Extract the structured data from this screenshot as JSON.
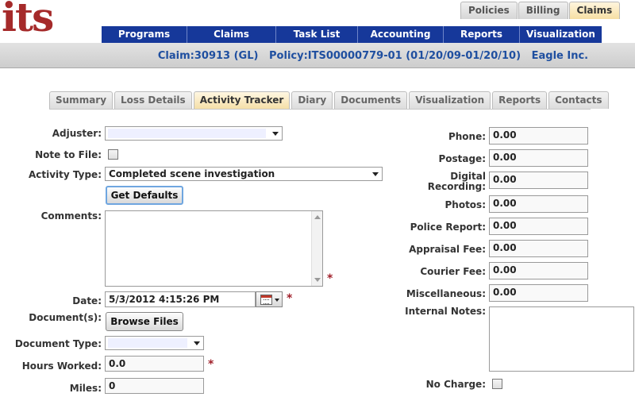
{
  "logo": "its",
  "top_tabs": [
    {
      "label": "Policies"
    },
    {
      "label": "Billing"
    },
    {
      "label": "Claims"
    }
  ],
  "main_nav": [
    {
      "label": "Programs"
    },
    {
      "label": "Claims"
    },
    {
      "label": "Task List"
    },
    {
      "label": "Accounting"
    },
    {
      "label": "Reports"
    },
    {
      "label": "Visualization"
    }
  ],
  "claim_bar": "Claim:30913 (GL)   Policy:ITS00000779-01 (01/20/09-01/20/10)   Eagle Inc.",
  "sub_tabs": [
    {
      "label": "Summary"
    },
    {
      "label": "Loss Details"
    },
    {
      "label": "Activity Tracker"
    },
    {
      "label": "Diary"
    },
    {
      "label": "Documents"
    },
    {
      "label": "Visualization"
    },
    {
      "label": "Reports"
    },
    {
      "label": "Contacts"
    }
  ],
  "form": {
    "adjuster_label": "Adjuster:",
    "adjuster_value": "",
    "note_to_file_label": "Note to File:",
    "activity_type_label": "Activity Type:",
    "activity_type_value": "Completed scene investigation",
    "get_defaults_label": "Get Defaults",
    "comments_label": "Comments:",
    "comments_value": "",
    "date_label": "Date:",
    "date_value": "5/3/2012 4:15:26 PM",
    "documents_label": "Document(s):",
    "browse_files_label": "Browse Files",
    "document_type_label": "Document Type:",
    "document_type_value": "",
    "hours_worked_label": "Hours Worked:",
    "hours_worked_value": "0.0",
    "miles_label": "Miles:",
    "miles_value": "0",
    "required_mark": "*"
  },
  "expenses": {
    "phone_label": "Phone:",
    "phone_value": "0.00",
    "postage_label": "Postage:",
    "postage_value": "0.00",
    "digital_recording_label_1": "Digital",
    "digital_recording_label_2": "Recording:",
    "digital_recording_value": "0.00",
    "photos_label": "Photos:",
    "photos_value": "0.00",
    "police_report_label": "Police Report:",
    "police_report_value": "0.00",
    "appraisal_fee_label": "Appraisal Fee:",
    "appraisal_fee_value": "0.00",
    "courier_fee_label": "Courier Fee:",
    "courier_fee_value": "0.00",
    "miscellaneous_label": "Miscellaneous:",
    "miscellaneous_value": "0.00",
    "internal_notes_label": "Internal Notes:",
    "internal_notes_value": "",
    "no_charge_label": "No Charge:"
  },
  "colors": {
    "nav_bg": "#16389a",
    "logo": "#a52a2a",
    "claim_text": "#1f4fa0",
    "active_tab": "#f5dfa8",
    "required": "#a0202a"
  }
}
